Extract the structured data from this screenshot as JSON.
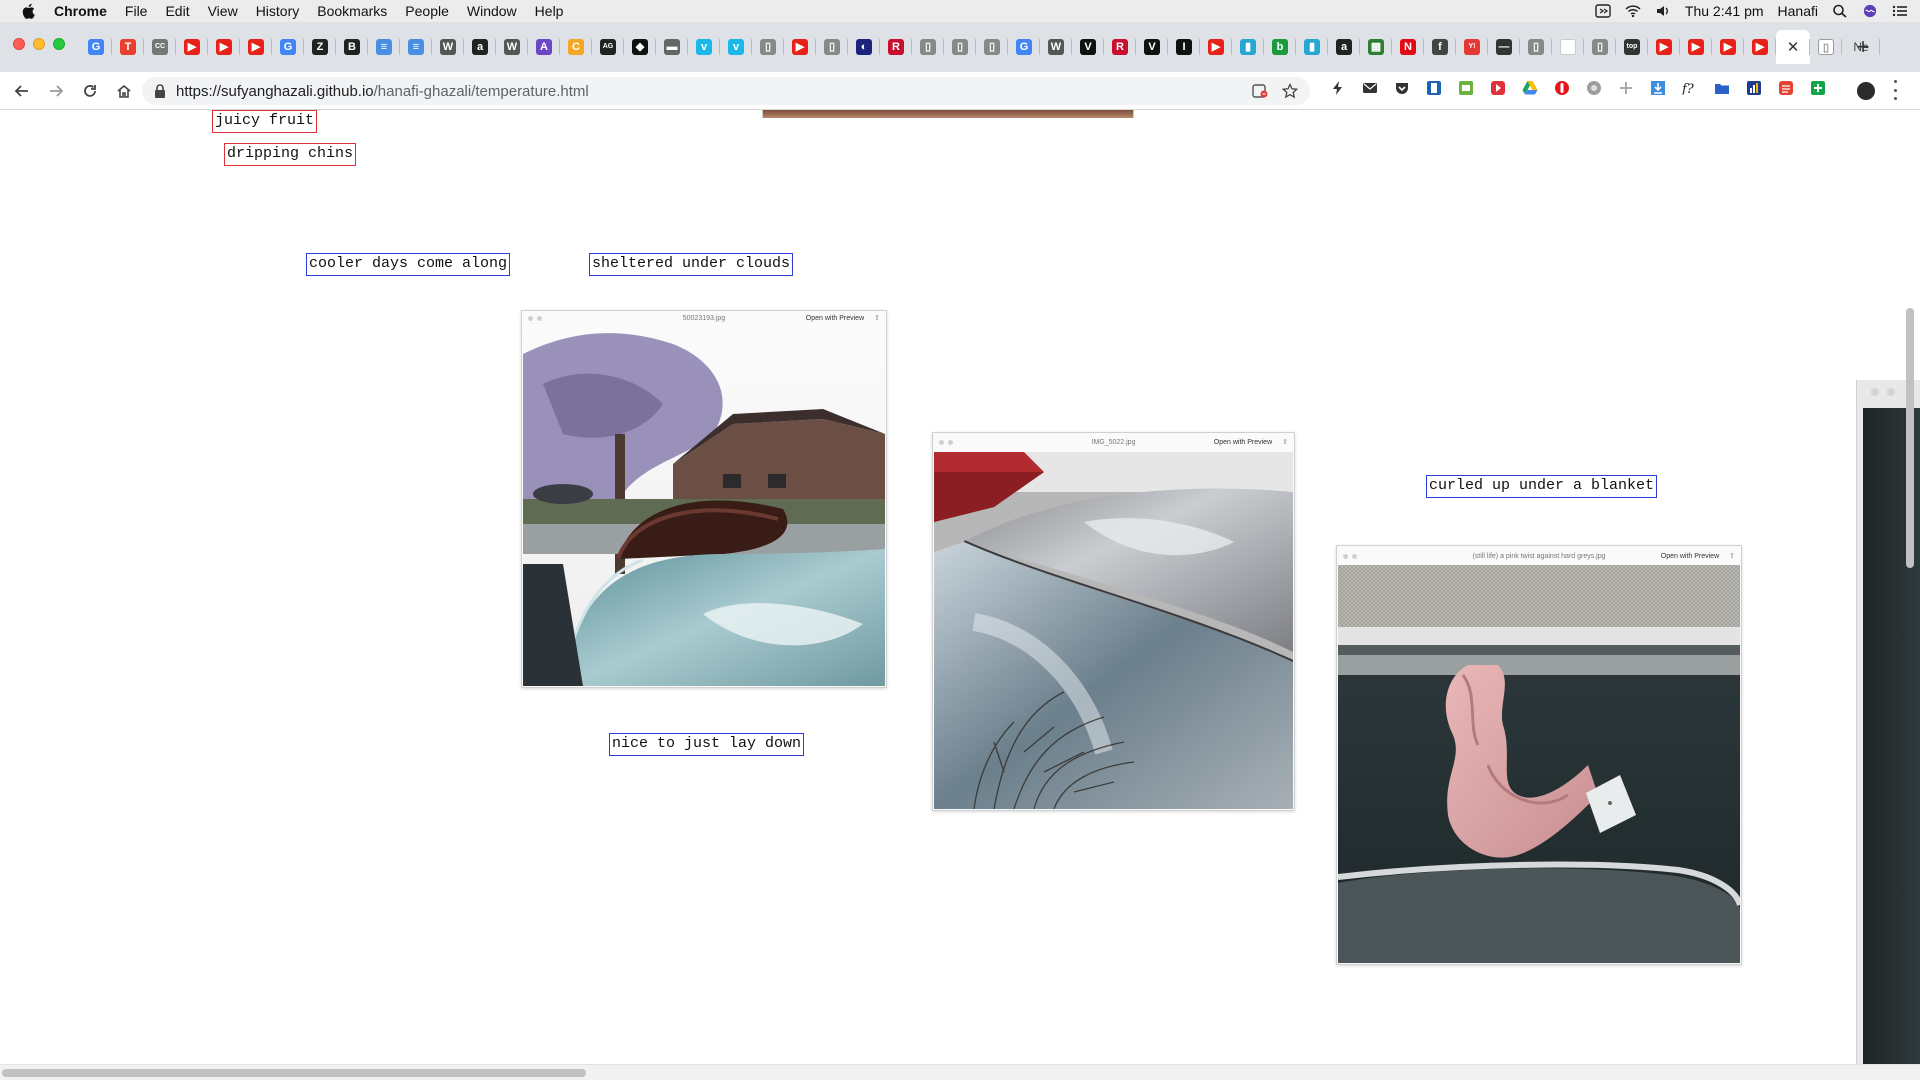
{
  "menubar": {
    "app": "Chrome",
    "menus": [
      "File",
      "Edit",
      "View",
      "History",
      "Bookmarks",
      "People",
      "Window",
      "Help"
    ],
    "clock": "Thu 2:41 pm",
    "user": "Hanafi"
  },
  "tabs": {
    "favicons": [
      {
        "icon": "google-icon",
        "glyph": "G",
        "color": "#4285f4"
      },
      {
        "icon": "t-icon",
        "glyph": "T",
        "color": "#e8402f"
      },
      {
        "icon": "cc-icon",
        "glyph": "CC",
        "color": "#777777"
      },
      {
        "icon": "youtube-icon",
        "glyph": "▶",
        "color": "#e62117"
      },
      {
        "icon": "youtube-icon",
        "glyph": "▶",
        "color": "#e62117"
      },
      {
        "icon": "youtube-icon",
        "glyph": "▶",
        "color": "#e62117"
      },
      {
        "icon": "google-icon",
        "glyph": "G",
        "color": "#4285f4"
      },
      {
        "icon": "z-icon",
        "glyph": "Z",
        "color": "#222222"
      },
      {
        "icon": "b-icon",
        "glyph": "B",
        "color": "#222222"
      },
      {
        "icon": "doc-icon",
        "glyph": "≡",
        "color": "#4a90e2"
      },
      {
        "icon": "doc-icon",
        "glyph": "≡",
        "color": "#4a90e2"
      },
      {
        "icon": "wsj-icon",
        "glyph": "W",
        "color": "#555555"
      },
      {
        "icon": "amazon-icon",
        "glyph": "a",
        "color": "#222222"
      },
      {
        "icon": "wsj-icon",
        "glyph": "W",
        "color": "#555555"
      },
      {
        "icon": "a-icon",
        "glyph": "A",
        "color": "#6b47c8"
      },
      {
        "icon": "c-icon",
        "glyph": "C",
        "color": "#f5a623"
      },
      {
        "icon": "agency-icon",
        "glyph": "AG",
        "color": "#222222"
      },
      {
        "icon": "diamond-icon",
        "glyph": "◆",
        "color": "#111111"
      },
      {
        "icon": "bar-icon",
        "glyph": "▬",
        "color": "#666666"
      },
      {
        "icon": "vimeo-icon",
        "glyph": "v",
        "color": "#1ab7ea"
      },
      {
        "icon": "vimeo-icon",
        "glyph": "v",
        "color": "#1ab7ea"
      },
      {
        "icon": "page-icon",
        "glyph": "▯",
        "color": "#888888"
      },
      {
        "icon": "youtube-icon",
        "glyph": "▶",
        "color": "#e62117"
      },
      {
        "icon": "page-icon",
        "glyph": "▯",
        "color": "#888888"
      },
      {
        "icon": "circle-icon",
        "glyph": "◐",
        "color": "#1a237e"
      },
      {
        "icon": "r-icon",
        "glyph": "R",
        "color": "#c8102e"
      },
      {
        "icon": "page-icon",
        "glyph": "▯",
        "color": "#888888"
      },
      {
        "icon": "page-icon",
        "glyph": "▯",
        "color": "#888888"
      },
      {
        "icon": "page-icon",
        "glyph": "▯",
        "color": "#888888"
      },
      {
        "icon": "google-icon",
        "glyph": "G",
        "color": "#4285f4"
      },
      {
        "icon": "wsj-icon",
        "glyph": "W",
        "color": "#555555"
      },
      {
        "icon": "v-icon",
        "glyph": "V",
        "color": "#111111"
      },
      {
        "icon": "r-icon",
        "glyph": "R",
        "color": "#c8102e"
      },
      {
        "icon": "v-icon",
        "glyph": "V",
        "color": "#111111"
      },
      {
        "icon": "i-icon",
        "glyph": "I",
        "color": "#111111"
      },
      {
        "icon": "youtube-icon",
        "glyph": "▶",
        "color": "#e62117"
      },
      {
        "icon": "bookmark-icon",
        "glyph": "▮",
        "color": "#26a6d1"
      },
      {
        "icon": "b-icon",
        "glyph": "b",
        "color": "#1c9a3e"
      },
      {
        "icon": "bookmark-icon",
        "glyph": "▮",
        "color": "#26a6d1"
      },
      {
        "icon": "amazon-icon",
        "glyph": "a",
        "color": "#222222"
      },
      {
        "icon": "grid-icon",
        "glyph": "▦",
        "color": "#2e7d32"
      },
      {
        "icon": "netflix-icon",
        "glyph": "N",
        "color": "#e50914"
      },
      {
        "icon": "f-icon",
        "glyph": "f",
        "color": "#444444"
      },
      {
        "icon": "yahoo-icon",
        "glyph": "Y!",
        "color": "#e53935"
      },
      {
        "icon": "dash-icon",
        "glyph": "—",
        "color": "#333333"
      },
      {
        "icon": "page-icon",
        "glyph": "▯",
        "color": "#888888"
      },
      {
        "icon": "blank-icon",
        "glyph": "",
        "color": "#ffffff"
      },
      {
        "icon": "page-icon",
        "glyph": "▯",
        "color": "#888888"
      },
      {
        "icon": "top-icon",
        "glyph": "top",
        "color": "#333333"
      },
      {
        "icon": "youtube-icon",
        "glyph": "▶",
        "color": "#e62117"
      },
      {
        "icon": "youtube-icon",
        "glyph": "▶",
        "color": "#e62117"
      },
      {
        "icon": "youtube-icon",
        "glyph": "▶",
        "color": "#e62117"
      },
      {
        "icon": "youtube-icon",
        "glyph": "▶",
        "color": "#e62117"
      }
    ],
    "last_tab_label": "Ne"
  },
  "toolbar": {
    "url_host": "https://sufyanghazali.github.io",
    "url_path": "/hanafi-ghazali/temperature.html"
  },
  "page": {
    "labels": {
      "juicy": "juicy fruit",
      "dripping": "dripping chins",
      "cooler": "cooler days come along",
      "sheltered": "sheltered under clouds",
      "nice": "nice to just lay down",
      "curled": "curled up under a blanket"
    },
    "windows": {
      "w1": {
        "filename": "50023193.jpg",
        "open_label": "Open with Preview"
      },
      "w2": {
        "filename": "IMG_5022.jpg",
        "open_label": "Open with Preview"
      },
      "w3": {
        "filename": "(still life) a pink twist against hard greys.jpg",
        "open_label": "Open with Preview"
      }
    }
  }
}
